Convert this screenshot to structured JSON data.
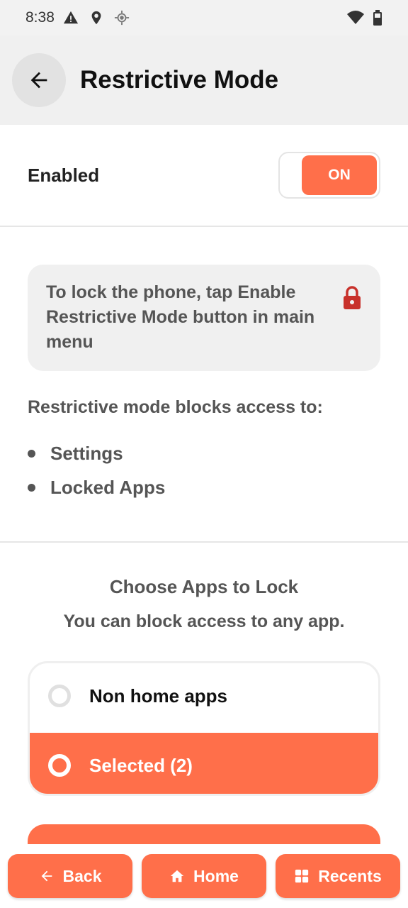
{
  "status_bar": {
    "time": "8:38"
  },
  "header": {
    "title": "Restrictive Mode"
  },
  "enabled_row": {
    "label": "Enabled",
    "toggle_label": "ON"
  },
  "info": {
    "text": "To lock the phone, tap Enable Restrictive Mode button in main menu"
  },
  "blocks": {
    "intro": "Restrictive mode blocks access to:",
    "items": [
      "Settings",
      "Locked Apps"
    ]
  },
  "choose": {
    "title": "Choose Apps to Lock",
    "subtitle": "You can block access to any app.",
    "options": [
      {
        "label": "Non home apps",
        "selected": false
      },
      {
        "label": "Selected (2)",
        "selected": true
      }
    ]
  },
  "nav": {
    "back": "Back",
    "home": "Home",
    "recents": "Recents"
  },
  "colors": {
    "accent": "#ff6f4a",
    "lock": "#c8312b"
  }
}
